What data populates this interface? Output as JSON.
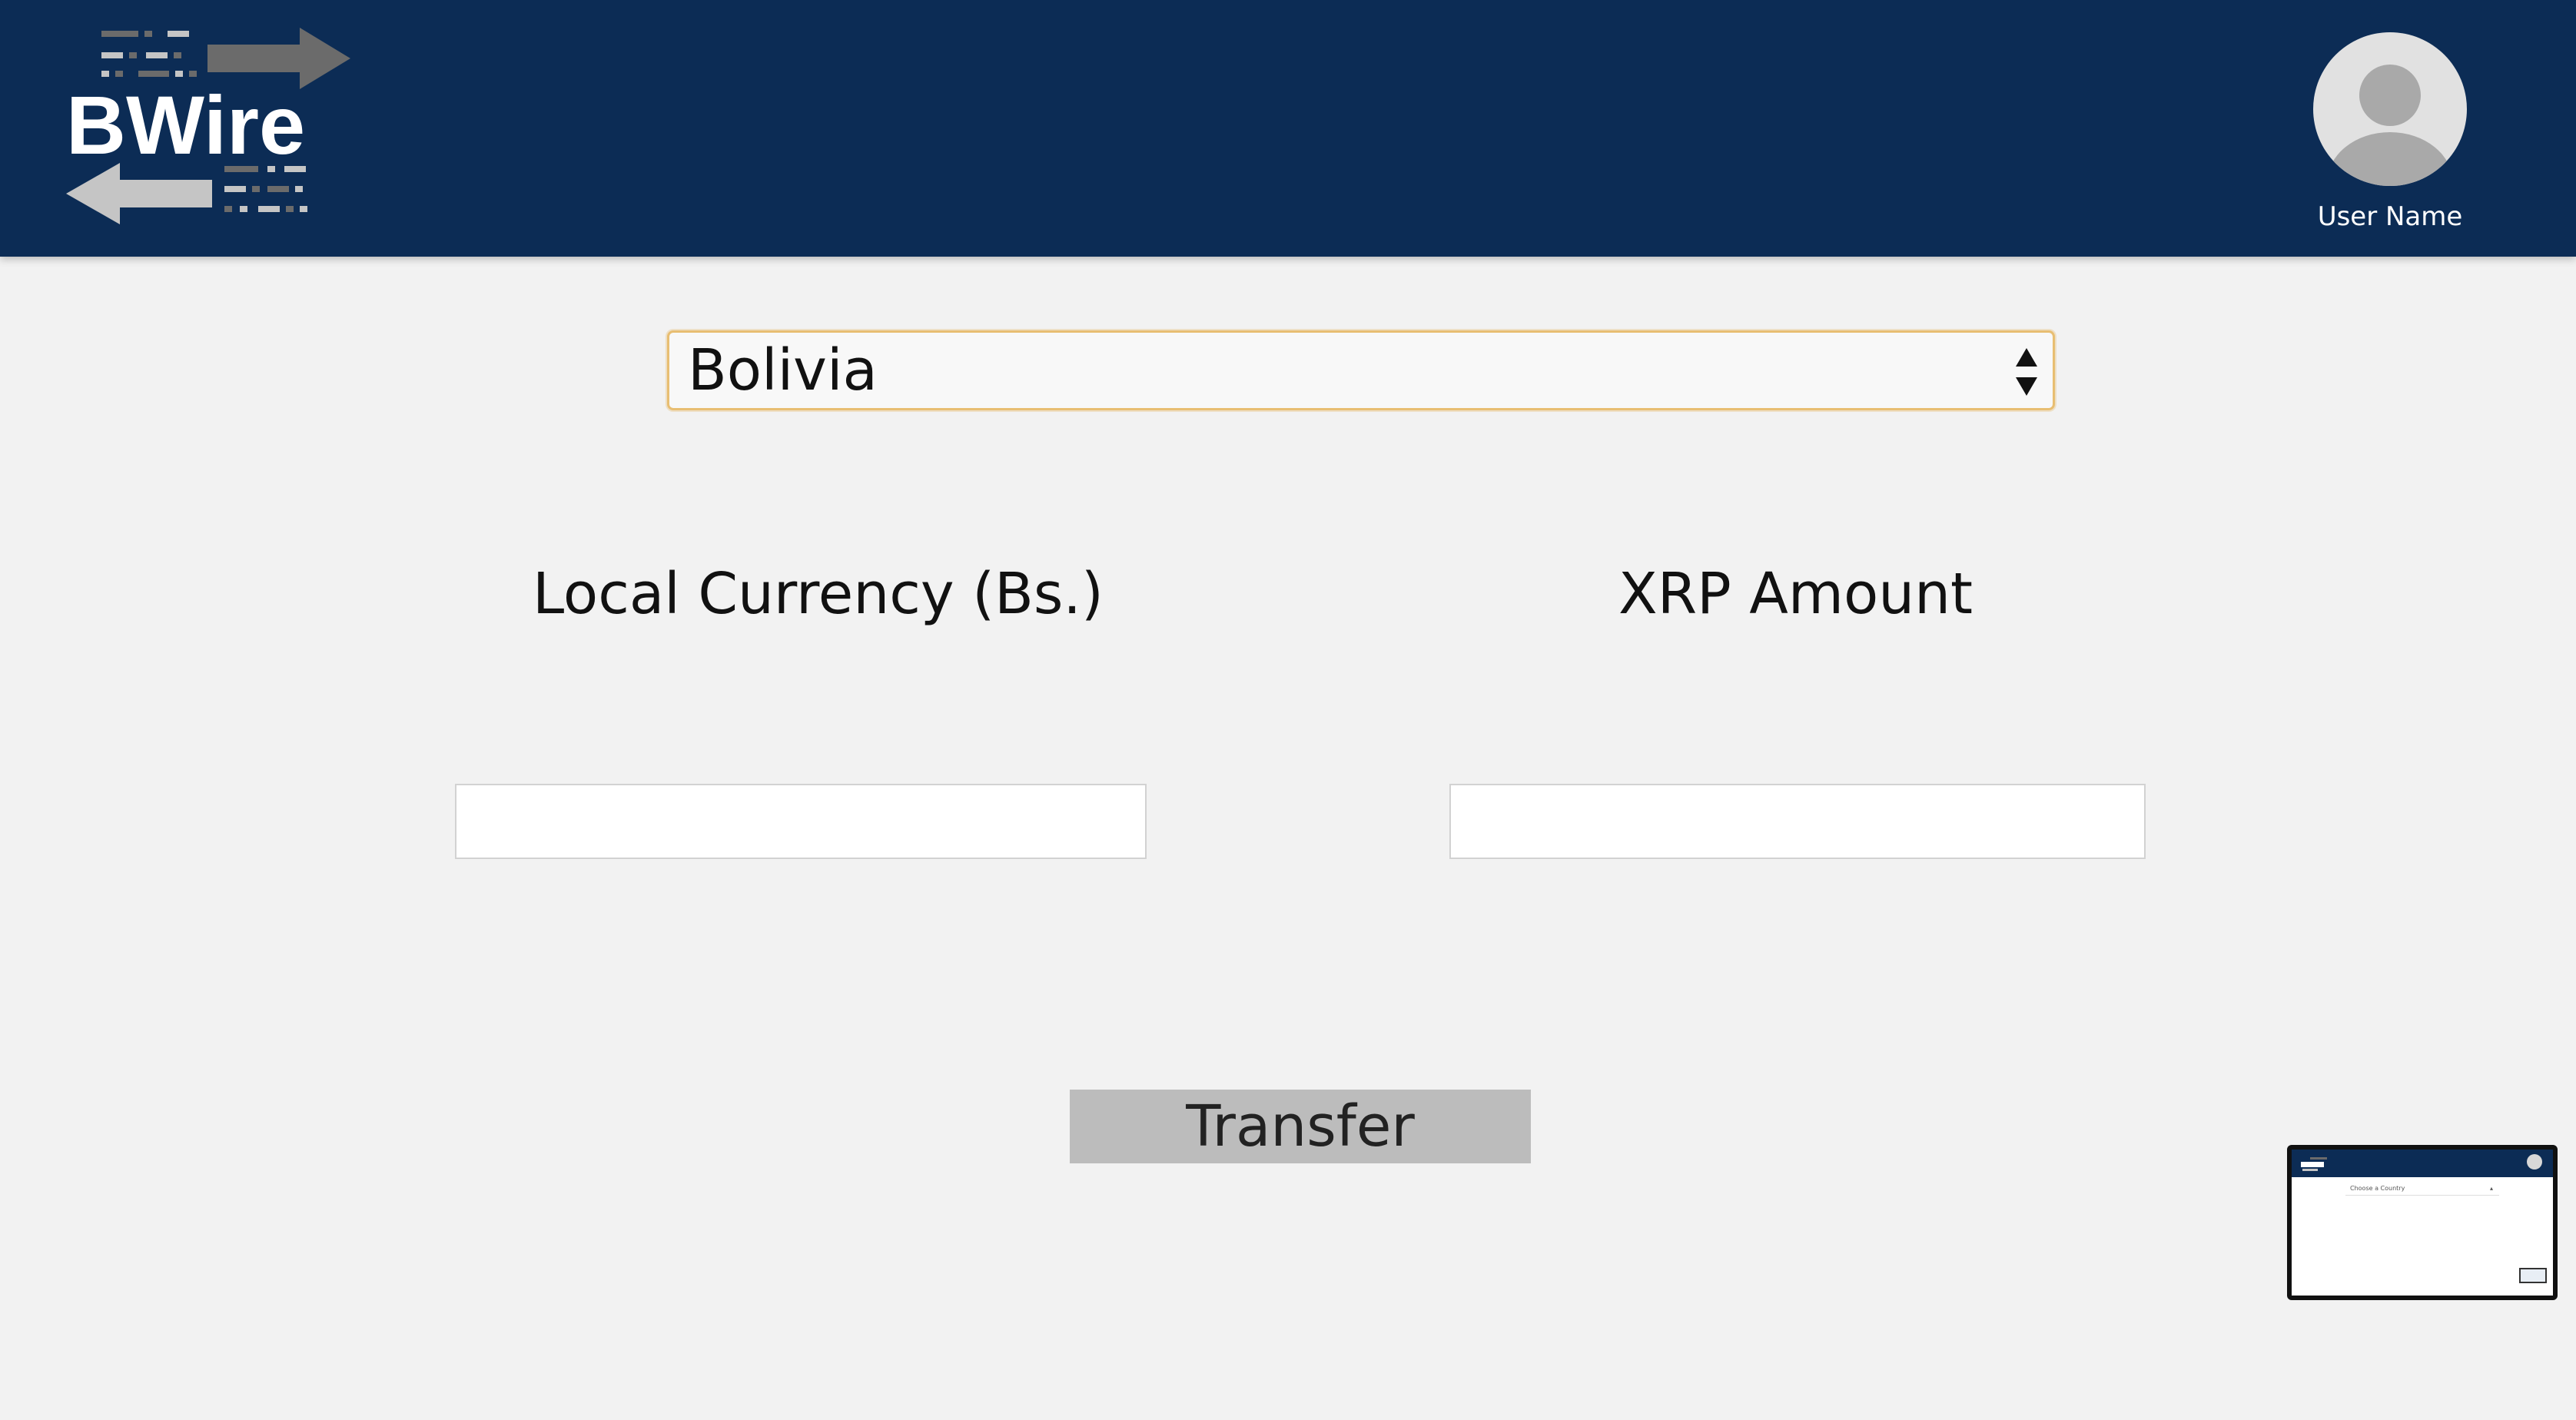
{
  "header": {
    "logo_text": "BWire",
    "user_name": "User Name",
    "colors": {
      "header_bg": "#0c2c55",
      "logo_gray": "#6b6b6b",
      "logo_light": "#c5c5c5"
    }
  },
  "form": {
    "country_select": {
      "selected": "Bolivia"
    },
    "local_currency_label": "Local Currency (Bs.)",
    "xrp_amount_label": "XRP Amount",
    "local_currency_value": "",
    "xrp_amount_value": "",
    "transfer_label": "Transfer"
  },
  "preview": {
    "select_placeholder": "Choose a Country"
  },
  "icons": [
    "avatar-icon",
    "select-arrows-icon",
    "left-arrow-icon",
    "right-arrow-icon"
  ]
}
